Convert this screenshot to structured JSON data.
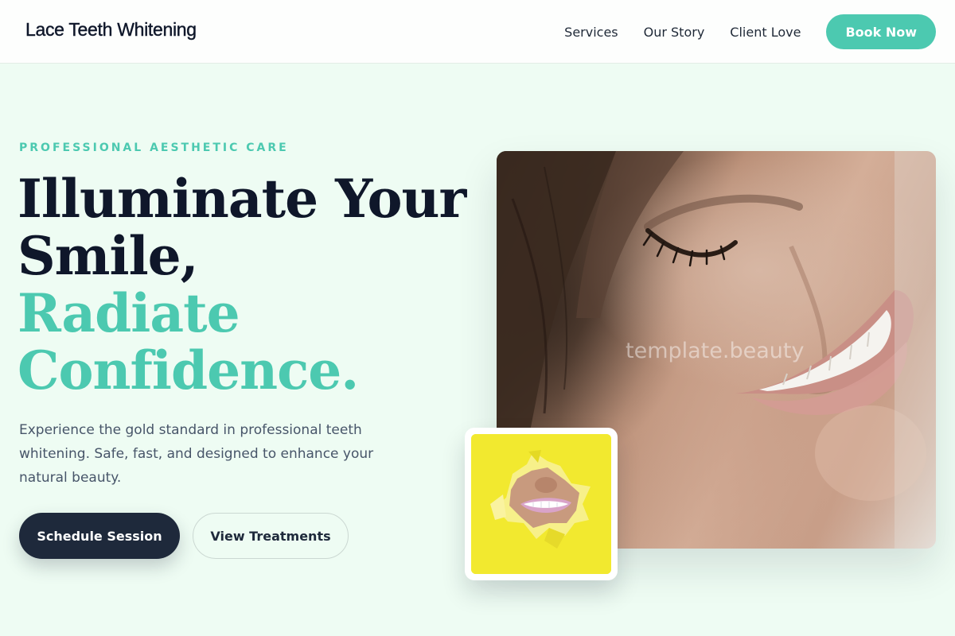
{
  "header": {
    "brand": "Lace Teeth Whitening",
    "nav": {
      "services": "Services",
      "our_story": "Our Story",
      "client_love": "Client Love"
    },
    "cta": "Book Now"
  },
  "hero": {
    "eyebrow": "PROFESSIONAL AESTHETIC CARE",
    "headline_line1": "Illuminate Your",
    "headline_line2": "Smile,",
    "headline_line3": "Radiate",
    "headline_line4": "Confidence.",
    "lead": "Experience the gold standard in professional teeth whitening. Safe, fast, and designed to enhance your natural beauty.",
    "primary_button": "Schedule Session",
    "secondary_button": "View Treatments",
    "watermark": "template.beauty"
  },
  "colors": {
    "accent": "#4cc9b0",
    "dark": "#0f172a",
    "button_dark": "#1e293b",
    "background": "#eefcf3",
    "thumb_yellow": "#f2e92f"
  }
}
